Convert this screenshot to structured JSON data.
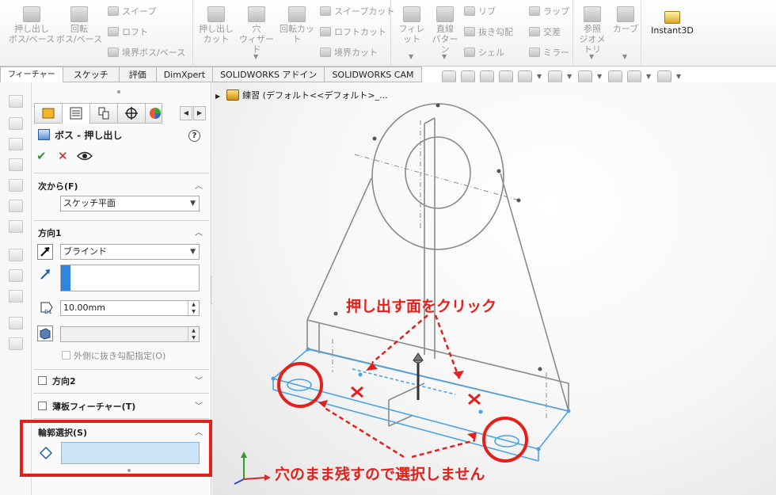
{
  "ribbon": {
    "extrude_boss": "押し出し\nボス/ベース",
    "revolve_boss": "回転\nボス/ベース",
    "sweep": "スイープ",
    "loft": "ロフト",
    "boundary_boss": "境界ボス/ベース",
    "extrude_cut": "押し出し\nカット",
    "hole_wizard": "穴\nウィザード",
    "revolve_cut": "回転カット",
    "sweep_cut": "スイープカット",
    "loft_cut": "ロフトカット",
    "boundary_cut": "境界カット",
    "fillet": "フィレット",
    "linear_pattern": "直線\nパターン",
    "rib": "リブ",
    "draft": "抜き勾配",
    "shell": "シェル",
    "wrap": "ラップ",
    "intersect": "交差",
    "mirror": "ミラー",
    "ref_geometry": "参照\nジオメトリ",
    "curves": "カーブ",
    "instant3d": "Instant3D"
  },
  "tabs": [
    "フィーチャー",
    "スケッチ",
    "評価",
    "DimXpert",
    "SOLIDWORKS アドイン",
    "SOLIDWORKS CAM"
  ],
  "tree": {
    "root": "練習 (デフォルト<<デフォルト>_..."
  },
  "pm": {
    "title": "ボス - 押し出し",
    "help": "?",
    "from_header": "次から(F)",
    "from_value": "スケッチ平面",
    "dir1_header": "方向1",
    "dir1_type": "ブラインド",
    "depth": "10.00mm",
    "draft_outward": "外側に抜き勾配指定(O)",
    "dir2_header": "方向2",
    "thin_header": "薄板フィーチャー(T)",
    "contour_header": "輪郭選択(S)"
  },
  "annotations": {
    "click_face": "押し出す面をクリック",
    "keep_holes": "穴のまま残すので選択しません"
  },
  "colors": {
    "accent_red": "#e2211c",
    "select_blue": "#cce4f7",
    "edge_blue": "#4aa3e8"
  }
}
